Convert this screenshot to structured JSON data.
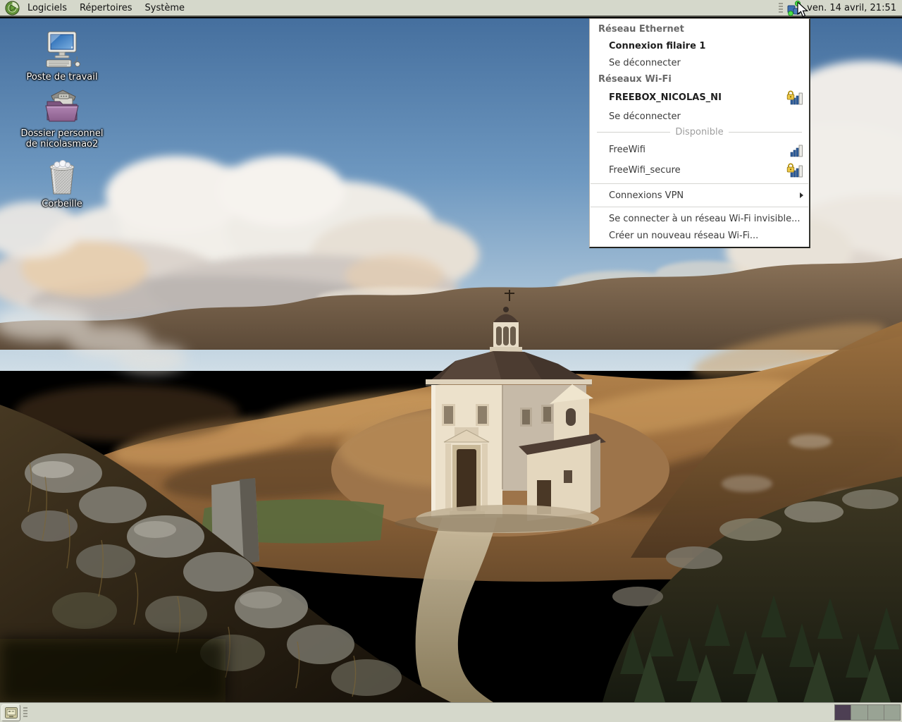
{
  "top_panel": {
    "menus": [
      {
        "label": "Logiciels"
      },
      {
        "label": "Répertoires"
      },
      {
        "label": "Système"
      }
    ],
    "clock": "ven. 14 avril, 21:51"
  },
  "network_menu": {
    "rows": [
      {
        "type": "header",
        "label": "Réseau Ethernet"
      },
      {
        "type": "item",
        "label": "Connexion filaire 1",
        "bold": true
      },
      {
        "type": "item",
        "label": "Se déconnecter"
      },
      {
        "type": "header",
        "label": "Réseaux Wi-Fi"
      },
      {
        "type": "item",
        "label": "FREEBOX_NICOLAS_NI",
        "bold": true,
        "icon": "wifi-signal-lock-icon"
      },
      {
        "type": "item",
        "label": "Se déconnecter"
      },
      {
        "type": "label-separator",
        "label": "Disponible"
      },
      {
        "type": "item",
        "label": "FreeWifi",
        "icon": "wifi-signal-icon"
      },
      {
        "type": "item",
        "label": "FreeWifi_secure",
        "icon": "wifi-signal-lock-icon"
      },
      {
        "type": "separator"
      },
      {
        "type": "item",
        "label": "Connexions VPN",
        "submenu": true
      },
      {
        "type": "separator"
      },
      {
        "type": "item",
        "label": "Se connecter à un réseau Wi-Fi invisible..."
      },
      {
        "type": "item",
        "label": "Créer un nouveau réseau Wi-Fi..."
      }
    ]
  },
  "desktop": {
    "icons": [
      {
        "label": "Poste de travail",
        "icon": "computer-icon"
      },
      {
        "label": "Dossier personnel de nicolasmao2",
        "icon": "home-folder-icon"
      },
      {
        "label": "Corbeille",
        "icon": "trash-icon"
      }
    ]
  },
  "bottom_panel": {
    "workspaces": {
      "count": 4,
      "active": 1
    }
  },
  "icons": {
    "logo": "distro-logo-icon",
    "network": "network-status-icon",
    "wifi": "wifi-signal-icon",
    "wifi_secure": "wifi-signal-lock-icon",
    "show_desktop": "show-desktop-icon",
    "cursor": "mouse-cursor-icon"
  },
  "colors": {
    "panel_bg": "#d5d8cb",
    "panel_border": "#54544c",
    "menu_bg": "#ffffff",
    "menu_header_text": "#686868",
    "menu_item_text": "#3a3a3a",
    "menu_disabled_text": "#9e9e9e",
    "wifi_bar_blue": "#2e5e9c",
    "lock_gold": "#edc844",
    "workspace_active": "#4d3f53",
    "workspace_inactive": "#99a394"
  }
}
